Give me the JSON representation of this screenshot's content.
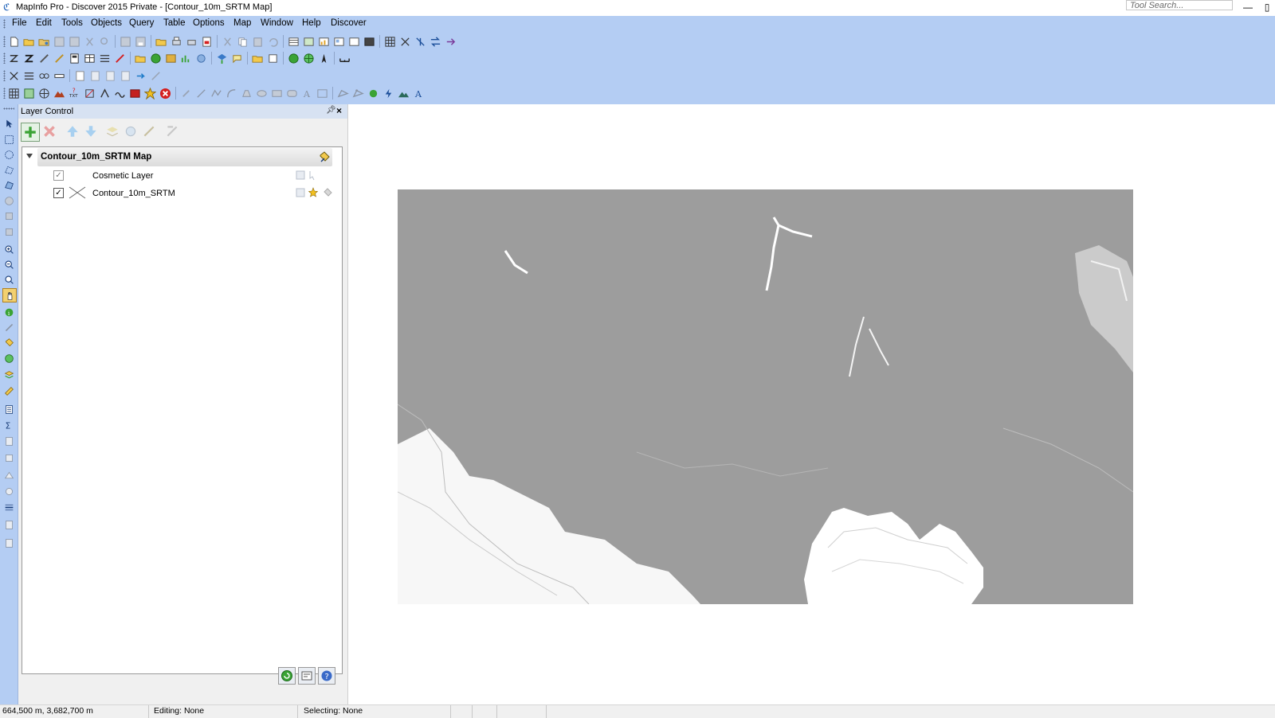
{
  "window": {
    "title": "MapInfo Pro - Discover 2015    Private - [Contour_10m_SRTM Map]",
    "tool_search_placeholder": "Tool Search...",
    "minimize": "—",
    "close": "✕"
  },
  "menubar": {
    "items": [
      "File",
      "Edit",
      "Tools",
      "Objects",
      "Query",
      "Table",
      "Options",
      "Map",
      "Window",
      "Help",
      "Discover"
    ]
  },
  "colors": {
    "ribbon": "#b4cdf3",
    "map_contours": "#9d9d9d",
    "accent_green": "#3aa335",
    "accent_red": "#d42020"
  },
  "layer_control": {
    "title": "Layer Control",
    "map_name": "Contour_10m_SRTM Map",
    "layers": [
      {
        "name": "Cosmetic Layer",
        "visible": true
      },
      {
        "name": "Contour_10m_SRTM",
        "visible": true
      }
    ]
  },
  "statusbar": {
    "coords": "664,500 m, 3,682,700 m",
    "editing": "Editing: None",
    "selecting": "Selecting: None"
  }
}
